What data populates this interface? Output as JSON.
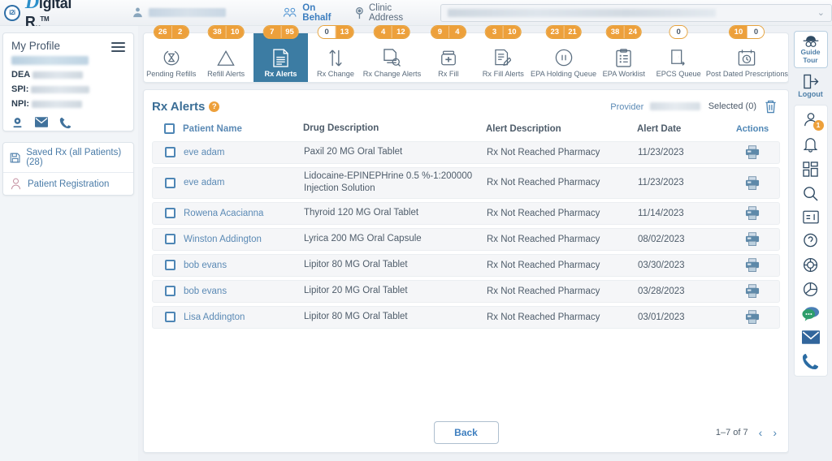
{
  "header": {
    "logo_mark": "i2i",
    "brand_d": "D",
    "brand_rest": "igital R",
    "brand_sub": "x",
    "brand_tm": "TM",
    "user_name_redacted": "",
    "on_behalf_label": "On Behalf",
    "clinic_address_label": "Clinic Address",
    "clinic_value_redacted": "",
    "caret": "⌄"
  },
  "sidebar": {
    "profile_title": "My Profile",
    "profile_name_redacted": "",
    "ids": [
      {
        "label": "DEA",
        "value_redacted": ""
      },
      {
        "label": "SPI:",
        "value_redacted": ""
      },
      {
        "label": "NPI:",
        "value_redacted": ""
      }
    ],
    "contact_icons": [
      "location-pin-icon",
      "envelope-icon",
      "phone-icon"
    ],
    "nav_items": [
      {
        "icon": "save-icon",
        "label": "Saved Rx (all Patients) (28)"
      },
      {
        "icon": "person-icon",
        "label": "Patient Registration"
      }
    ]
  },
  "tabs": [
    {
      "id": "pending-refills",
      "label": "Pending Refills",
      "icon": "hourglass-refresh-icon",
      "badges": [
        {
          "value": "26",
          "style": "orange"
        },
        {
          "value": "2",
          "style": "orange"
        }
      ],
      "active": false
    },
    {
      "id": "refill-alerts",
      "label": "Refill Alerts",
      "icon": "warning-triangle-icon",
      "badges": [
        {
          "value": "38",
          "style": "orange"
        },
        {
          "value": "10",
          "style": "orange"
        }
      ],
      "active": false
    },
    {
      "id": "rx-alerts",
      "label": "Rx Alerts",
      "icon": "document-alert-icon",
      "badges": [
        {
          "value": "7",
          "style": "orange"
        },
        {
          "value": "95",
          "style": "orange"
        }
      ],
      "active": true
    },
    {
      "id": "rx-change",
      "label": "Rx Change",
      "icon": "up-down-arrows-icon",
      "badges": [
        {
          "value": "0",
          "style": "white"
        },
        {
          "value": "13",
          "style": "orange"
        }
      ],
      "active": false
    },
    {
      "id": "rx-change-alerts",
      "label": "Rx Change Alerts",
      "icon": "document-stack-icon",
      "badges": [
        {
          "value": "4",
          "style": "orange"
        },
        {
          "value": "12",
          "style": "orange"
        }
      ],
      "active": false
    },
    {
      "id": "rx-fill",
      "label": "Rx Fill",
      "icon": "pill-bottle-icon",
      "badges": [
        {
          "value": "9",
          "style": "orange"
        },
        {
          "value": "4",
          "style": "orange"
        }
      ],
      "active": false
    },
    {
      "id": "rx-fill-alerts",
      "label": "Rx Fill Alerts",
      "icon": "document-pen-icon",
      "badges": [
        {
          "value": "3",
          "style": "orange"
        },
        {
          "value": "10",
          "style": "orange"
        }
      ],
      "active": false
    },
    {
      "id": "epa-holding-queue",
      "label": "EPA Holding Queue",
      "icon": "pause-circle-icon",
      "badges": [
        {
          "value": "23",
          "style": "orange"
        },
        {
          "value": "21",
          "style": "orange"
        }
      ],
      "active": false
    },
    {
      "id": "epa-worklist",
      "label": "EPA Worklist",
      "icon": "clipboard-list-icon",
      "badges": [
        {
          "value": "38",
          "style": "orange"
        },
        {
          "value": "24",
          "style": "orange"
        }
      ],
      "active": false
    },
    {
      "id": "epcs-queue",
      "label": "EPCS Queue",
      "icon": "door-exit-icon",
      "badges": [
        {
          "value": "0",
          "style": "white"
        }
      ],
      "active": false
    },
    {
      "id": "post-dated-prescriptions",
      "label": "Post Dated Prescriptions",
      "icon": "calendar-clock-icon",
      "badges": [
        {
          "value": "10",
          "style": "orange"
        },
        {
          "value": "0",
          "style": "white"
        }
      ],
      "active": false
    }
  ],
  "main": {
    "title": "Rx Alerts",
    "help_glyph": "?",
    "provider_label": "Provider",
    "provider_value_redacted": "",
    "selected_label": "Selected (0)",
    "delete_icon": "trash-icon",
    "columns": [
      "Patient Name",
      "Drug Description",
      "Alert Description",
      "Alert Date",
      "Actions"
    ],
    "rows": [
      {
        "patient": "eve adam",
        "drug": "Paxil 20 MG Oral Tablet",
        "alert": "Rx Not Reached Pharmacy",
        "date": "11/23/2023"
      },
      {
        "patient": "eve adam",
        "drug": "Lidocaine-EPINEPHrine 0.5 %-1:200000 Injection Solution",
        "alert": "Rx Not Reached Pharmacy",
        "date": "11/23/2023"
      },
      {
        "patient": "Rowena Acacianna",
        "drug": "Thyroid 120 MG Oral Tablet",
        "alert": "Rx Not Reached Pharmacy",
        "date": "11/14/2023"
      },
      {
        "patient": "Winston Addington",
        "drug": "Lyrica 200 MG Oral Capsule",
        "alert": "Rx Not Reached Pharmacy",
        "date": "08/02/2023"
      },
      {
        "patient": "bob evans",
        "drug": "Lipitor 80 MG Oral Tablet",
        "alert": "Rx Not Reached Pharmacy",
        "date": "03/30/2023"
      },
      {
        "patient": "bob evans",
        "drug": "Lipitor 20 MG Oral Tablet",
        "alert": "Rx Not Reached Pharmacy",
        "date": "03/28/2023"
      },
      {
        "patient": "Lisa Addington",
        "drug": "Lipitor 80 MG Oral Tablet",
        "alert": "Rx Not Reached Pharmacy",
        "date": "03/01/2023"
      }
    ]
  },
  "footer": {
    "back_label": "Back",
    "pager_text": "1–7 of 7",
    "prev_glyph": "‹",
    "next_glyph": "›"
  },
  "rail": {
    "guide_line1": "Guide",
    "guide_line2": "Tour",
    "guide_icon": "detective-hat-icon",
    "logout_label": "Logout",
    "logout_icon": "logout-arrow-icon",
    "icons": [
      {
        "name": "person-icon",
        "badge": "1"
      },
      {
        "name": "bell-icon",
        "badge": ""
      },
      {
        "name": "dashboard-grid-icon",
        "badge": ""
      },
      {
        "name": "search-icon",
        "badge": ""
      },
      {
        "name": "card-list-icon",
        "badge": ""
      },
      {
        "name": "help-bubble-icon",
        "badge": ""
      },
      {
        "name": "lifebuoy-icon",
        "badge": ""
      },
      {
        "name": "pie-chart-icon",
        "badge": ""
      },
      {
        "name": "chat-bubble-icon",
        "badge": ""
      },
      {
        "name": "mail-icon",
        "badge": ""
      },
      {
        "name": "phone-icon",
        "badge": ""
      }
    ]
  },
  "colors": {
    "accent_blue": "#3c7ca3",
    "badge_orange": "#eda03b",
    "link_blue": "#5b8ab5",
    "page_bg": "#eef1f5"
  }
}
